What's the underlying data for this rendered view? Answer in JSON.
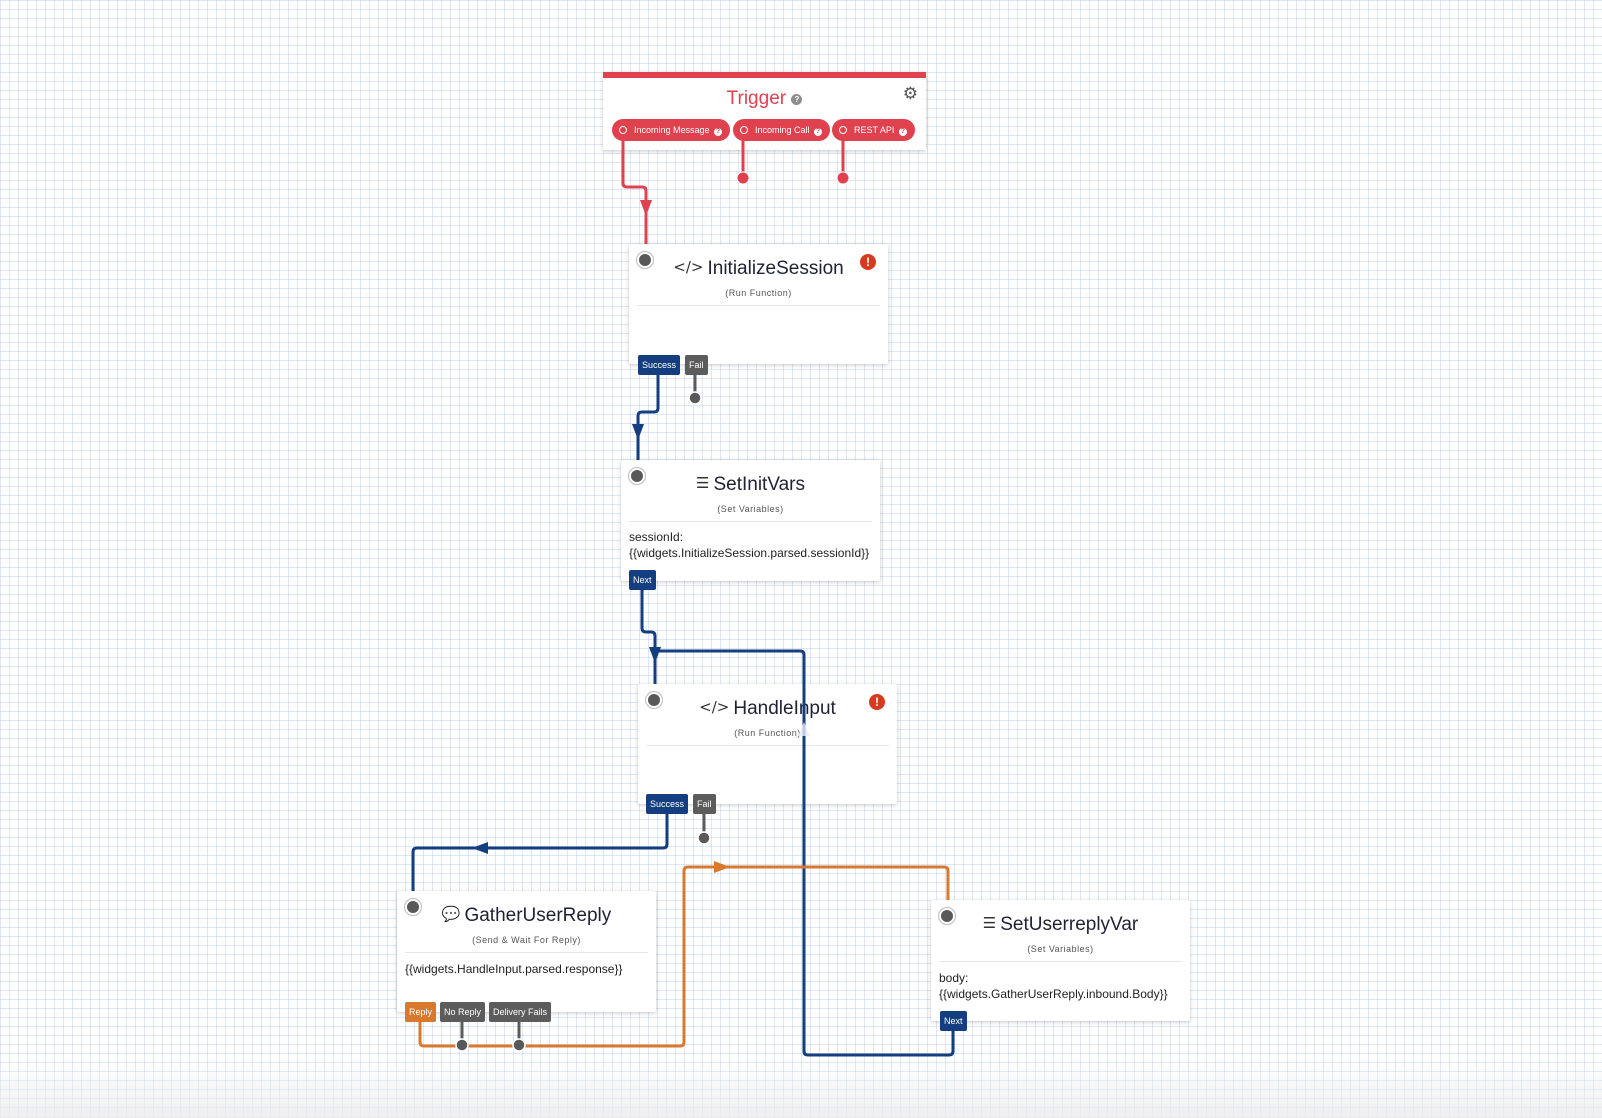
{
  "trigger": {
    "title": "Trigger",
    "help_icon": "?",
    "settings_icon": "gear-icon",
    "inputs": [
      {
        "label": "Incoming Message"
      },
      {
        "label": "Incoming Call"
      },
      {
        "label": "REST API"
      }
    ],
    "color": "#e0414f"
  },
  "nodes": {
    "initialize_session": {
      "icon": "</>",
      "title": "InitializeSession",
      "type": "(Run Function)",
      "has_error": true,
      "error_icon": "!",
      "transitions": [
        "Success",
        "Fail"
      ]
    },
    "set_init_vars": {
      "icon": "☰",
      "title": "SetInitVars",
      "type": "(Set Variables)",
      "body_line1": "sessionId:",
      "body_line2": "{{widgets.InitializeSession.parsed.sessionId}}",
      "transitions": [
        "Next"
      ]
    },
    "handle_input": {
      "icon": "</>",
      "title": "HandleInput",
      "type": "(Run Function)",
      "has_error": true,
      "error_icon": "!",
      "transitions": [
        "Success",
        "Fail"
      ]
    },
    "gather_user_reply": {
      "icon": "💬",
      "title": "GatherUserReply",
      "type": "(Send & Wait For Reply)",
      "body_line1": "{{widgets.HandleInput.parsed.response}}",
      "transitions": [
        "Reply",
        "No Reply",
        "Delivery Fails"
      ]
    },
    "set_userreply_var": {
      "icon": "☰",
      "title": "SetUserreplyVar",
      "type": "(Set Variables)",
      "body_line1": "body:",
      "body_line2": "{{widgets.GatherUserReply.inbound.Body}}",
      "transitions": [
        "Next"
      ]
    }
  },
  "colors": {
    "trigger": "#e0414f",
    "success": "#153e80",
    "fail": "#5c5c5c",
    "reply": "#d9792e",
    "error": "#d63b20"
  }
}
